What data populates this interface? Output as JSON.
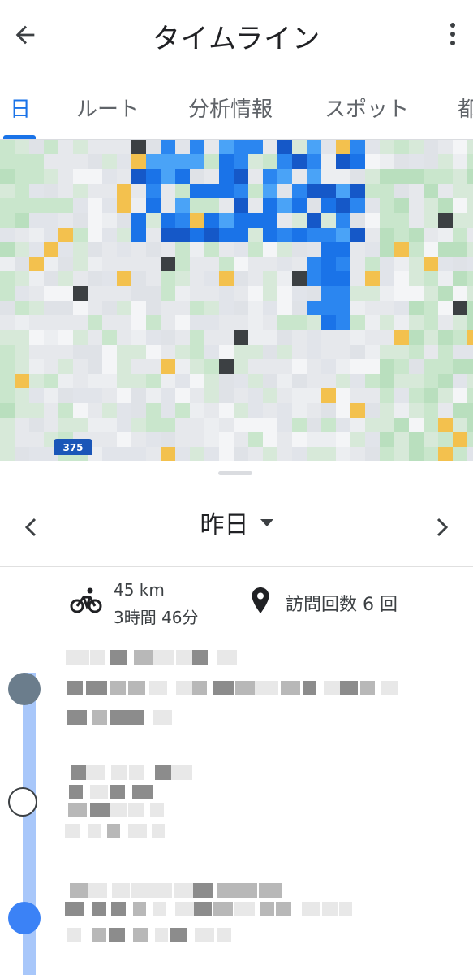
{
  "appbar": {
    "title": "タイムライン",
    "back_icon": "arrow-back-icon",
    "more_icon": "more-vert-icon"
  },
  "tabs": [
    {
      "label": "日",
      "active": true
    },
    {
      "label": "ルート",
      "active": false
    },
    {
      "label": "分析情報",
      "active": false
    },
    {
      "label": "スポット",
      "active": false
    },
    {
      "label": "都",
      "active": false
    }
  ],
  "map": {
    "route_badge": "375"
  },
  "date_nav": {
    "date": "昨日",
    "prev_icon": "chevron-left-icon",
    "next_icon": "chevron-right-icon",
    "dropdown_icon": "arrow-drop-down-icon"
  },
  "summary": {
    "distance": "45 km",
    "duration": "3時間 46分",
    "visits": "訪問回数 6 回",
    "activity_icon": "bicycle-icon",
    "place_icon": "place-pin-icon"
  },
  "colors": {
    "accent": "#1a73e8",
    "timeline_line": "#a8c7fa"
  }
}
